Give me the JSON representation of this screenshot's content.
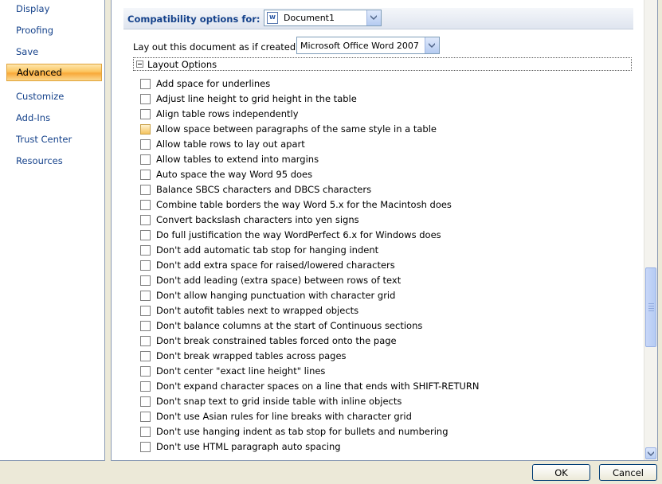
{
  "nav": {
    "items": [
      {
        "label": "Display",
        "active": false
      },
      {
        "label": "Proofing",
        "active": false
      },
      {
        "label": "Save",
        "active": false
      },
      {
        "label": "Advanced",
        "active": true
      },
      {
        "label": "Customize",
        "active": false
      },
      {
        "label": "Add-Ins",
        "active": false
      },
      {
        "label": "Trust Center",
        "active": false
      },
      {
        "label": "Resources",
        "active": false
      }
    ]
  },
  "compat": {
    "label": "Compatibility options for:",
    "document": "Document1",
    "layout_label": "Lay out this document as if created in:",
    "version": "Microsoft Office Word 2007"
  },
  "layout_group": {
    "title": "Layout Options",
    "options": [
      {
        "label": "Add space for underlines",
        "checked": false
      },
      {
        "label": "Adjust line height to grid height in the table",
        "checked": false
      },
      {
        "label": "Align table rows independently",
        "checked": false
      },
      {
        "label": "Allow space between paragraphs of the same style in a table",
        "checked": false
      },
      {
        "label": "Allow table rows to lay out apart",
        "checked": false
      },
      {
        "label": "Allow tables to extend into margins",
        "checked": false
      },
      {
        "label": "Auto space the way Word 95 does",
        "checked": false
      },
      {
        "label": "Balance SBCS characters and DBCS characters",
        "checked": false
      },
      {
        "label": "Combine table borders the way Word 5.x for the Macintosh does",
        "checked": false
      },
      {
        "label": "Convert backslash characters into yen signs",
        "checked": false
      },
      {
        "label": "Do full justification the way WordPerfect 6.x for Windows does",
        "checked": false
      },
      {
        "label": "Don't add automatic tab stop for hanging indent",
        "checked": false
      },
      {
        "label": "Don't add extra space for raised/lowered characters",
        "checked": false
      },
      {
        "label": "Don't add leading (extra space) between rows of text",
        "checked": false
      },
      {
        "label": "Don't allow hanging punctuation with character grid",
        "checked": false
      },
      {
        "label": "Don't autofit tables next to wrapped objects",
        "checked": false
      },
      {
        "label": "Don't balance columns at the start of Continuous sections",
        "checked": false
      },
      {
        "label": "Don't break constrained tables forced onto the page",
        "checked": false
      },
      {
        "label": "Don't break wrapped tables across pages",
        "checked": false
      },
      {
        "label": "Don't center \"exact line height\" lines",
        "checked": false
      },
      {
        "label": "Don't expand character spaces on a line that ends with SHIFT-RETURN",
        "checked": false
      },
      {
        "label": "Don't snap text to grid inside table with inline objects",
        "checked": false
      },
      {
        "label": "Don't use Asian rules for line breaks with character grid",
        "checked": false
      },
      {
        "label": "Don't use hanging indent as tab stop for bullets and numbering",
        "checked": false
      },
      {
        "label": "Don't use HTML paragraph auto spacing",
        "checked": false
      }
    ]
  },
  "buttons": {
    "ok": "OK",
    "cancel": "Cancel"
  },
  "colors": {
    "accent": "#15428b",
    "active_nav": "#f8a838"
  },
  "icons": {
    "document": "word-document-icon",
    "dropdown": "chevron-down-icon",
    "collapse": "minus-box-icon"
  }
}
